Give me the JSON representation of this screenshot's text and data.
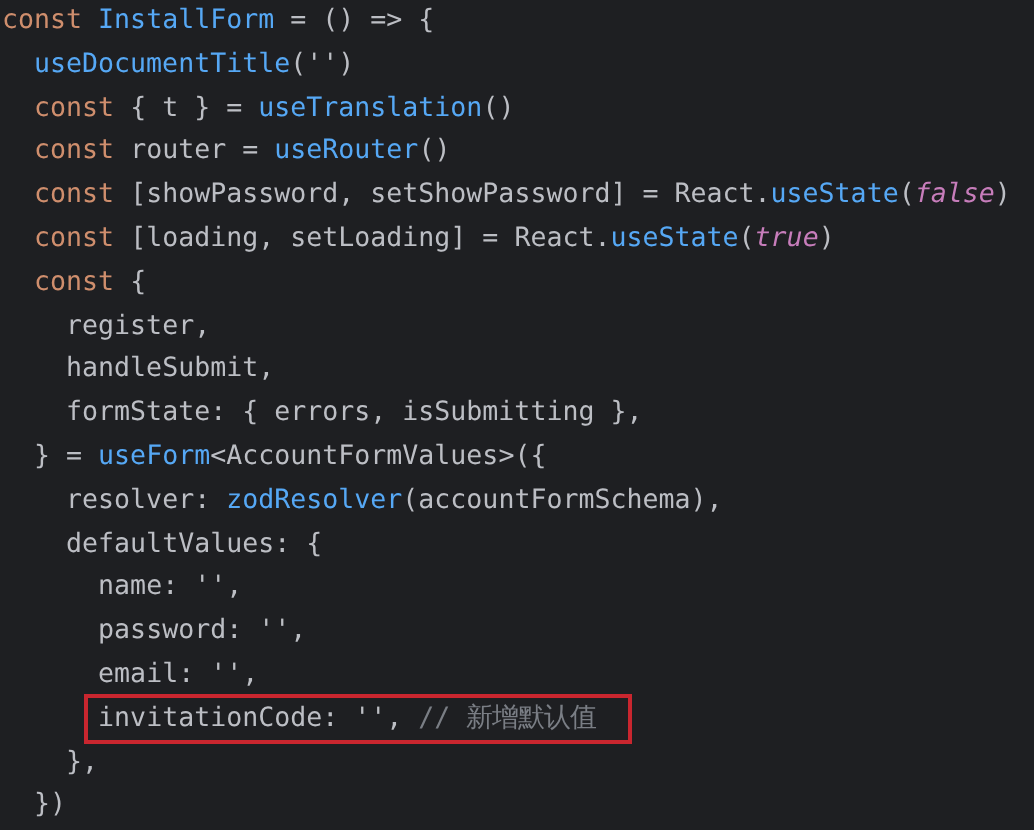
{
  "editor": {
    "lines": [
      {
        "highlighted": false,
        "tokens": [
          {
            "kind": "keyword",
            "text": "const "
          },
          {
            "kind": "function",
            "text": "InstallForm"
          },
          {
            "kind": "plain",
            "text": " = () => {"
          }
        ]
      },
      {
        "highlighted": false,
        "tokens": [
          {
            "kind": "function",
            "text": "  useDocumentTitle"
          },
          {
            "kind": "plain",
            "text": "('')"
          }
        ]
      },
      {
        "highlighted": false,
        "tokens": [
          {
            "kind": "keyword",
            "text": "  const "
          },
          {
            "kind": "plain",
            "text": "{ t } = "
          },
          {
            "kind": "function",
            "text": "useTranslation"
          },
          {
            "kind": "plain",
            "text": "()"
          }
        ]
      },
      {
        "highlighted": false,
        "tokens": [
          {
            "kind": "keyword",
            "text": "  const "
          },
          {
            "kind": "plain",
            "text": "router = "
          },
          {
            "kind": "function",
            "text": "useRouter"
          },
          {
            "kind": "plain",
            "text": "()"
          }
        ]
      },
      {
        "highlighted": false,
        "tokens": [
          {
            "kind": "keyword",
            "text": "  const "
          },
          {
            "kind": "plain",
            "text": "[showPassword, setShowPassword] = React."
          },
          {
            "kind": "function",
            "text": "useState"
          },
          {
            "kind": "plain",
            "text": "("
          },
          {
            "kind": "literal",
            "text": "false"
          },
          {
            "kind": "plain",
            "text": ")"
          }
        ]
      },
      {
        "highlighted": false,
        "tokens": [
          {
            "kind": "keyword",
            "text": "  const "
          },
          {
            "kind": "plain",
            "text": "[loading, setLoading] = React."
          },
          {
            "kind": "function",
            "text": "useState"
          },
          {
            "kind": "plain",
            "text": "("
          },
          {
            "kind": "literal",
            "text": "true"
          },
          {
            "kind": "plain",
            "text": ")"
          }
        ]
      },
      {
        "highlighted": false,
        "tokens": [
          {
            "kind": "keyword",
            "text": "  const "
          },
          {
            "kind": "plain",
            "text": "{"
          }
        ]
      },
      {
        "highlighted": false,
        "tokens": [
          {
            "kind": "plain",
            "text": "    register,"
          }
        ]
      },
      {
        "highlighted": false,
        "tokens": [
          {
            "kind": "plain",
            "text": "    handleSubmit,"
          }
        ]
      },
      {
        "highlighted": false,
        "tokens": [
          {
            "kind": "plain",
            "text": "    formState: { errors, isSubmitting },"
          }
        ]
      },
      {
        "highlighted": false,
        "tokens": [
          {
            "kind": "plain",
            "text": "  } = "
          },
          {
            "kind": "function",
            "text": "useForm"
          },
          {
            "kind": "plain",
            "text": "<AccountFormValues>({"
          }
        ]
      },
      {
        "highlighted": false,
        "tokens": [
          {
            "kind": "plain",
            "text": "    resolver: "
          },
          {
            "kind": "function",
            "text": "zodResolver"
          },
          {
            "kind": "plain",
            "text": "(accountFormSchema),"
          }
        ]
      },
      {
        "highlighted": false,
        "tokens": [
          {
            "kind": "plain",
            "text": "    defaultValues: {"
          }
        ]
      },
      {
        "highlighted": false,
        "tokens": [
          {
            "kind": "plain",
            "text": "      name: '',"
          }
        ]
      },
      {
        "highlighted": false,
        "tokens": [
          {
            "kind": "plain",
            "text": "      password: '',"
          }
        ]
      },
      {
        "highlighted": false,
        "tokens": [
          {
            "kind": "plain",
            "text": "      email: '',"
          }
        ]
      },
      {
        "highlighted": true,
        "tokens": [
          {
            "kind": "plain",
            "text": "      invitationCode: '', "
          },
          {
            "kind": "comment",
            "text": "// 新增默认值"
          }
        ]
      },
      {
        "highlighted": false,
        "tokens": [
          {
            "kind": "plain",
            "text": "    },"
          }
        ]
      },
      {
        "highlighted": false,
        "tokens": [
          {
            "kind": "plain",
            "text": "  })"
          }
        ]
      }
    ]
  }
}
